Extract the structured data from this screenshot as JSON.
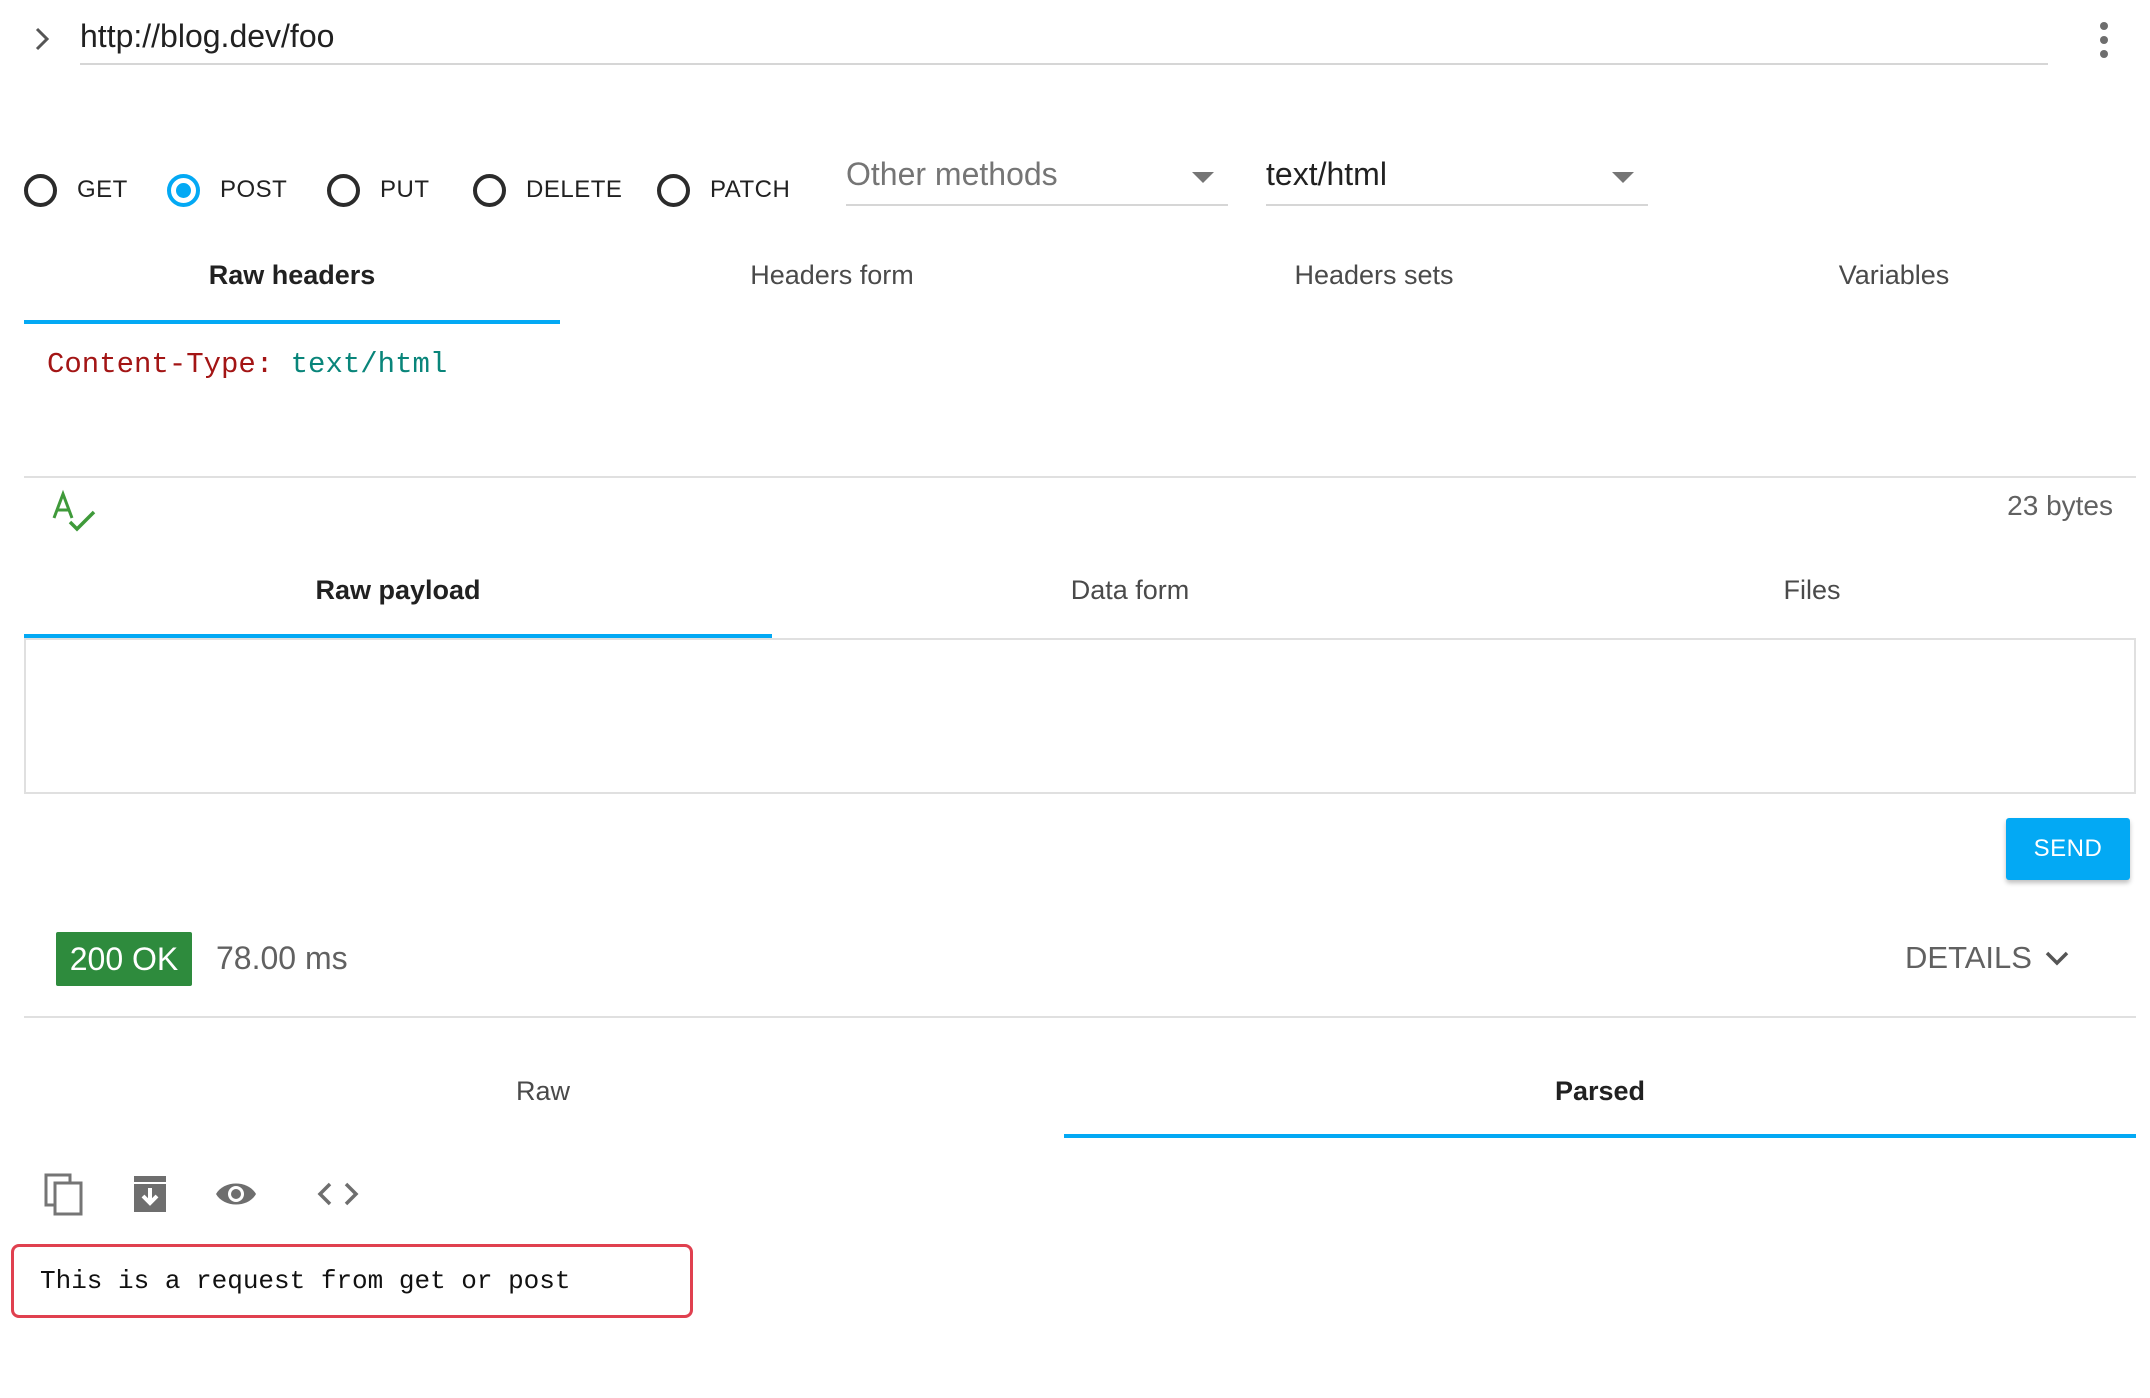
{
  "url_bar": {
    "url": "http://blog.dev/foo"
  },
  "methods": {
    "options": [
      "GET",
      "POST",
      "PUT",
      "DELETE",
      "PATCH"
    ],
    "selected": "POST",
    "other_methods_placeholder": "Other methods",
    "content_type": "text/html"
  },
  "header_tabs": {
    "tabs": [
      "Raw headers",
      "Headers form",
      "Headers sets",
      "Variables"
    ],
    "active": "Raw headers"
  },
  "headers_editor": {
    "key": "Content-Type:",
    "value": "text/html"
  },
  "headers_footer": {
    "size": "23 bytes"
  },
  "payload_tabs": {
    "tabs": [
      "Raw payload",
      "Data form",
      "Files"
    ],
    "active": "Raw payload"
  },
  "actions": {
    "send_label": "SEND"
  },
  "response_status": {
    "status": "200 OK",
    "status_color": "#2e8b3d",
    "time": "78.00 ms",
    "details_label": "DETAILS"
  },
  "response_tabs": {
    "tabs": [
      "Raw",
      "Parsed"
    ],
    "active": "Parsed"
  },
  "response_toolbar": {
    "icons": [
      "copy-icon",
      "save-icon",
      "preview-icon",
      "code-icon"
    ]
  },
  "response_body": {
    "text": "This is a request from get or post"
  },
  "colors": {
    "accent": "#03a9f4",
    "highlight_border": "#e0404f"
  }
}
